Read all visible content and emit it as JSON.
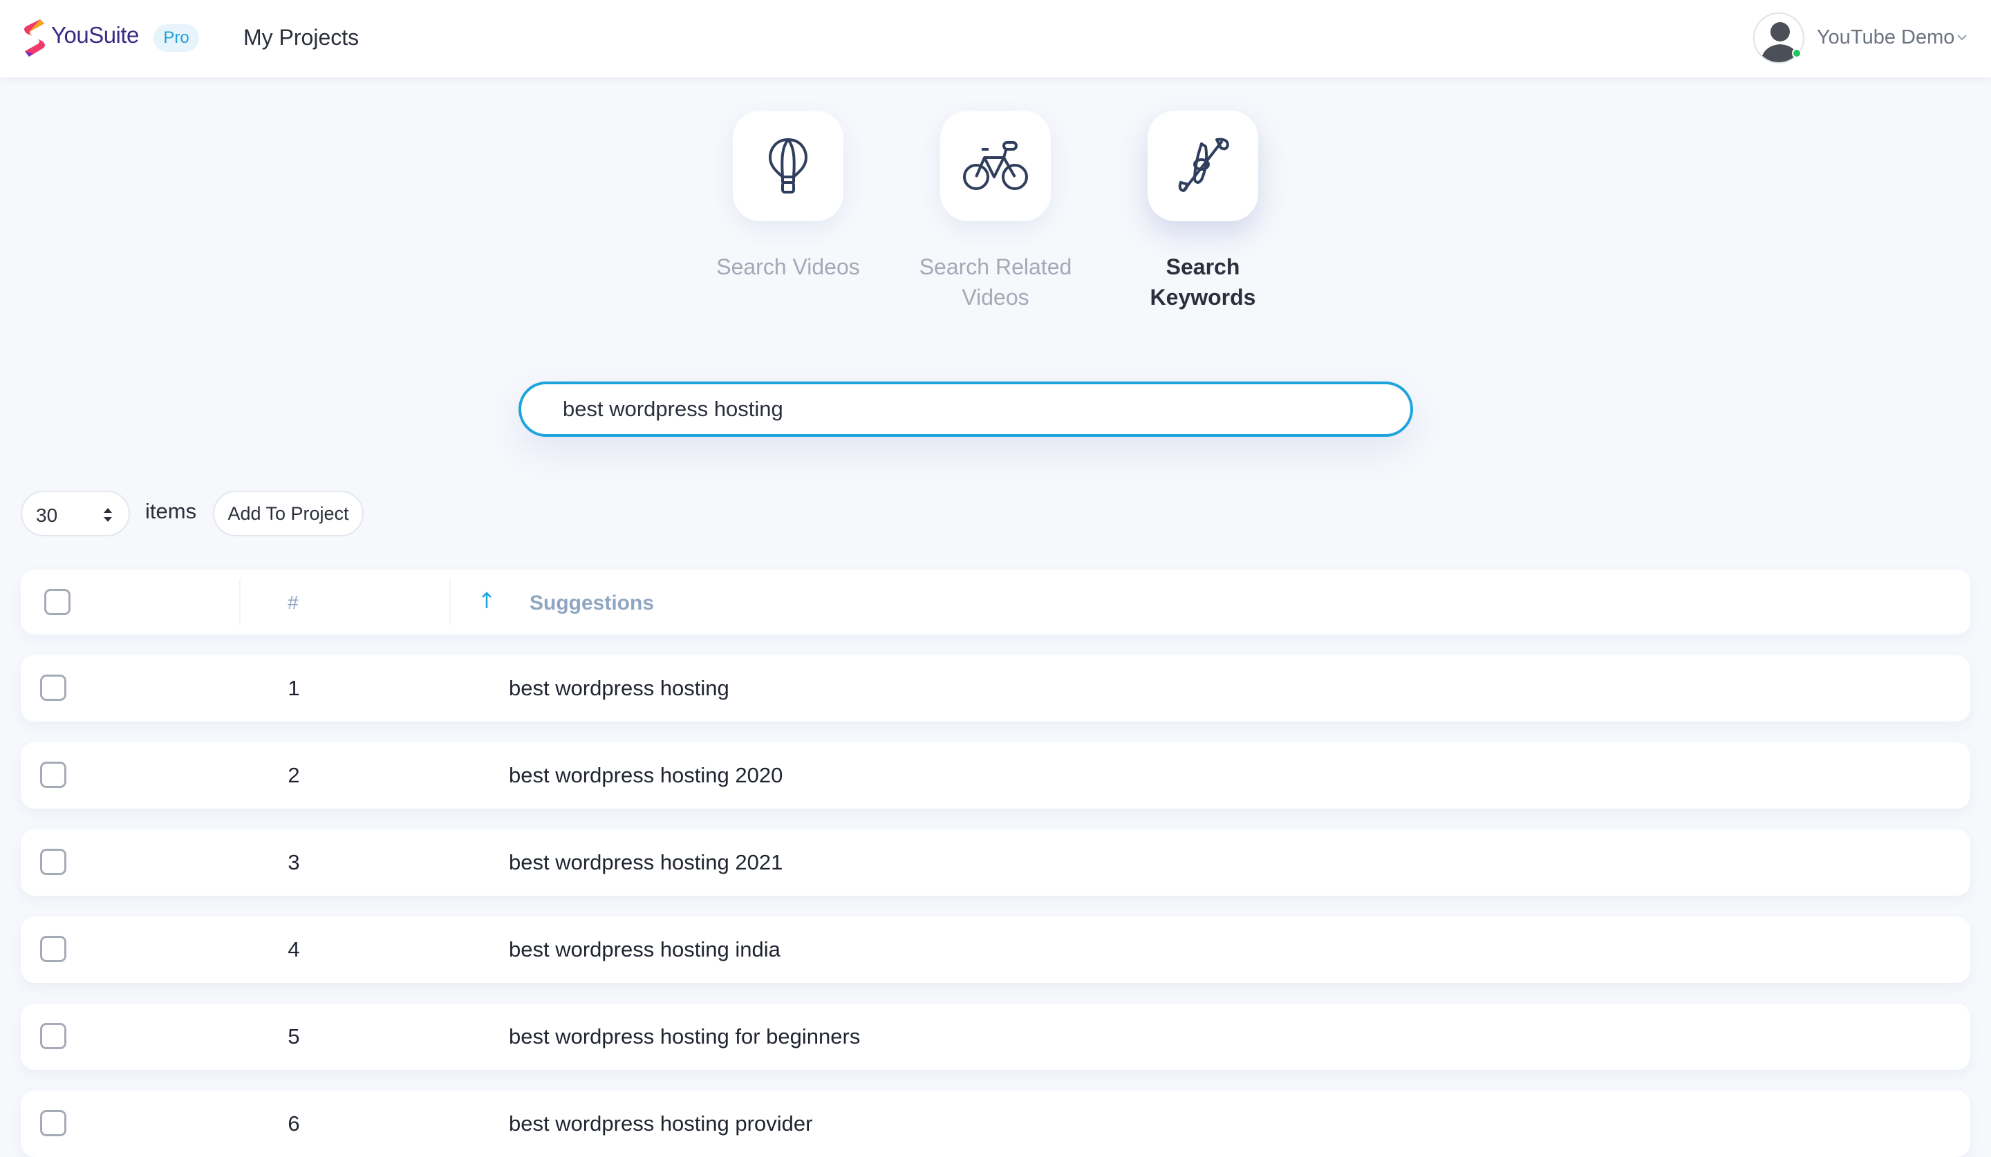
{
  "app": {
    "brand": "YouSuite",
    "badge": "Pro",
    "nav_projects": "My Projects",
    "user_name": "YouTube Demo",
    "brand_color": "#3b2a86",
    "accent_color": "#1ea4dc"
  },
  "modes": [
    {
      "label_line1": "Search Videos",
      "label_line2": "",
      "icon": "hot-air-balloon-icon",
      "active": false
    },
    {
      "label_line1": "Search Related",
      "label_line2": "Videos",
      "icon": "bicycle-icon",
      "active": false
    },
    {
      "label_line1": "Search Keywords",
      "label_line2": "",
      "icon": "kayak-paddle-icon",
      "active": true
    }
  ],
  "search": {
    "value": "best wordpress hosting",
    "placeholder": ""
  },
  "controls": {
    "page_size": "30",
    "items_label": "items",
    "add_to_project": "Add To Project"
  },
  "table": {
    "col_number": "#",
    "col_suggestions": "Suggestions",
    "sort_direction": "ascending",
    "rows": [
      {
        "num": "1",
        "suggestion": "best wordpress hosting"
      },
      {
        "num": "2",
        "suggestion": "best wordpress hosting 2020"
      },
      {
        "num": "3",
        "suggestion": "best wordpress hosting 2021"
      },
      {
        "num": "4",
        "suggestion": "best wordpress hosting india"
      },
      {
        "num": "5",
        "suggestion": "best wordpress hosting for beginners"
      },
      {
        "num": "6",
        "suggestion": "best wordpress hosting provider"
      }
    ]
  }
}
